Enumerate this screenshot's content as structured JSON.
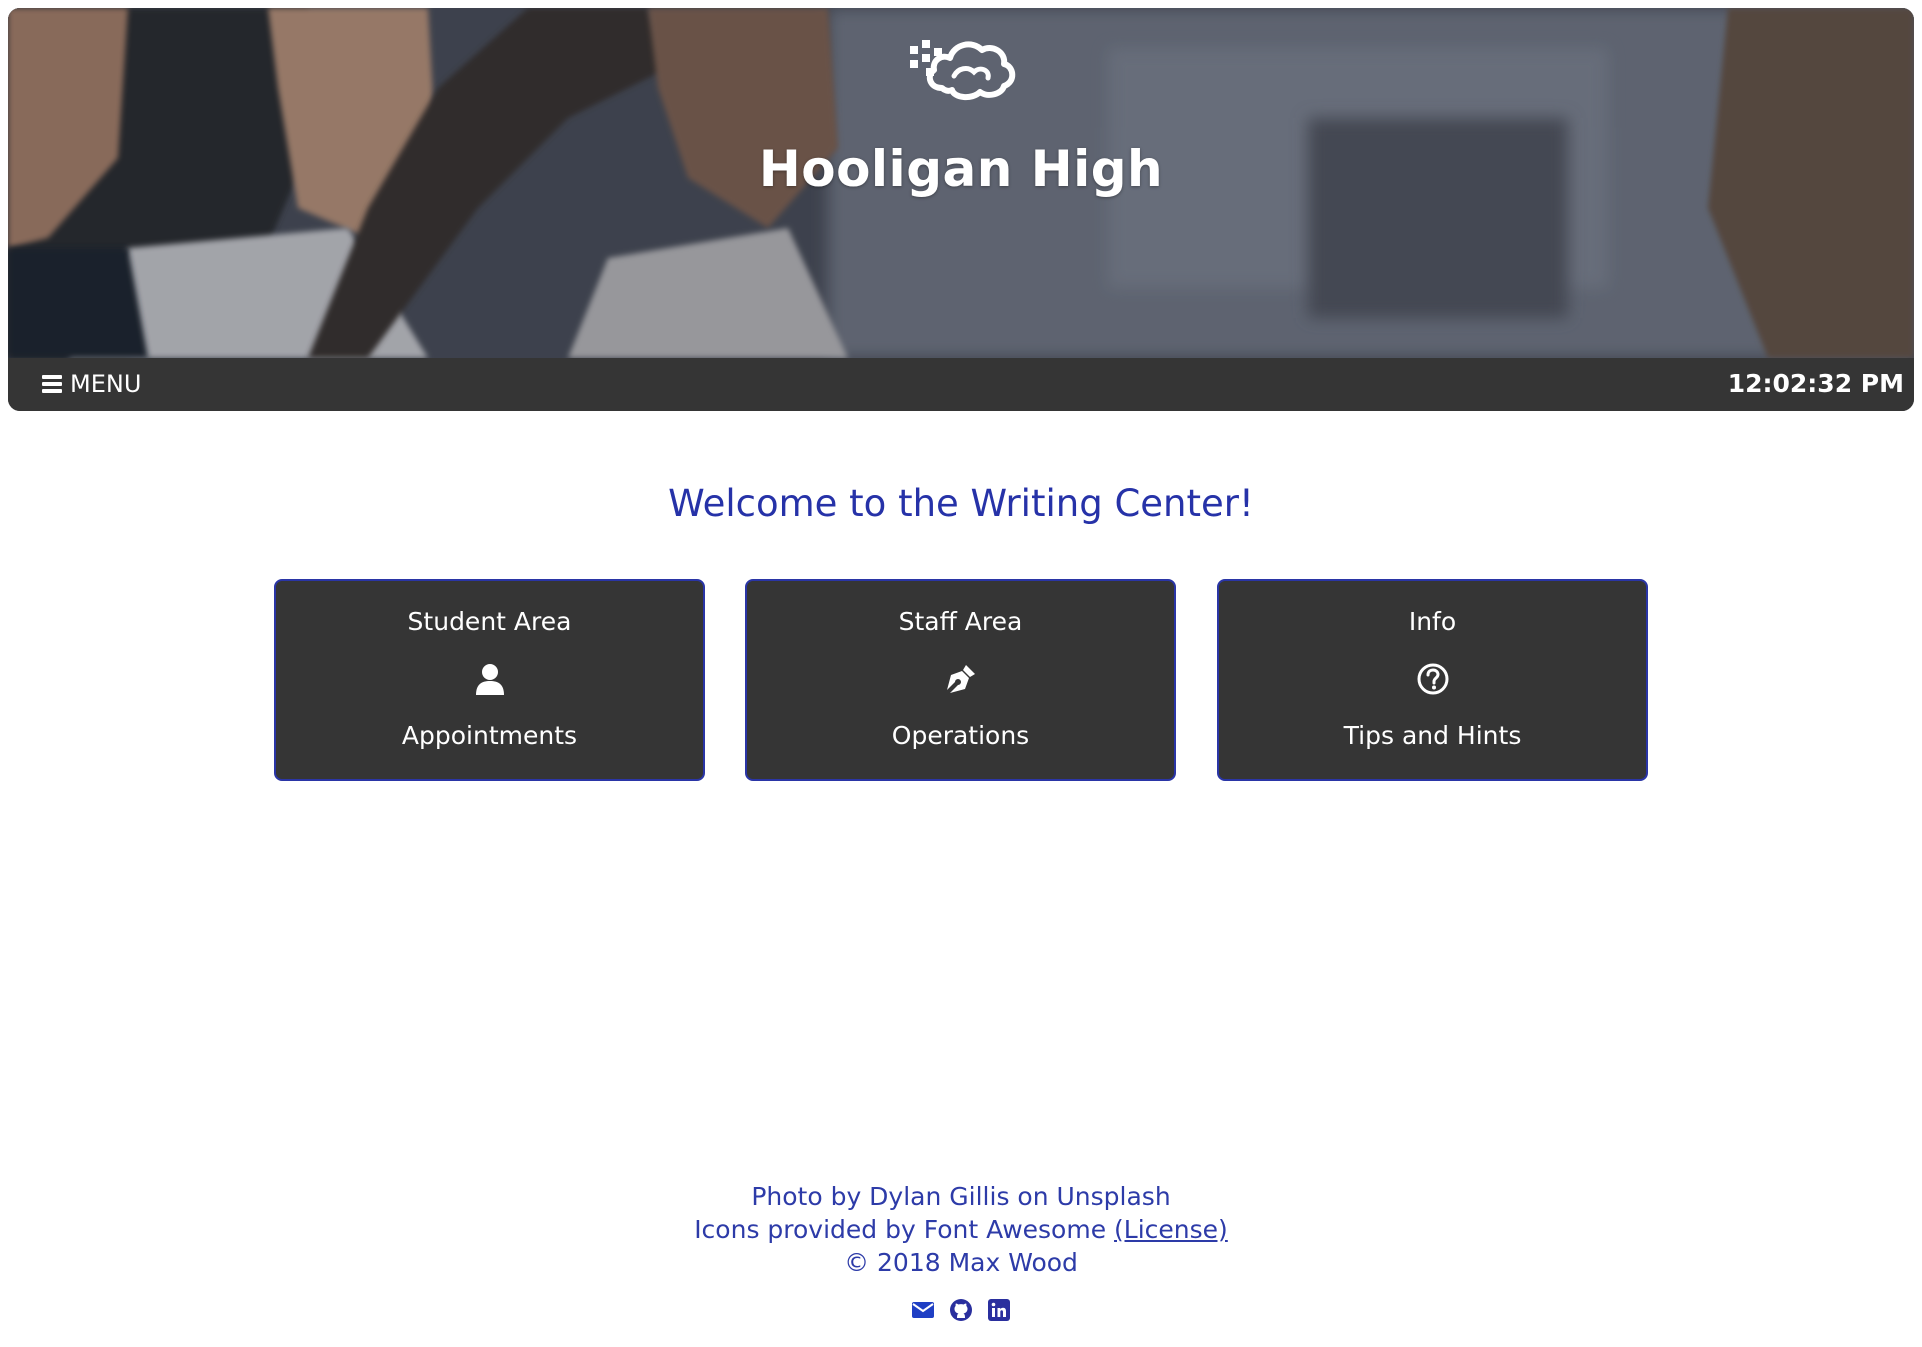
{
  "header": {
    "site_title": "Hooligan High",
    "logo_icon": "cloud-logo-icon",
    "menu_label": "MENU",
    "menu_icon": "bars-icon",
    "clock": "12:02:32 PM"
  },
  "main": {
    "welcome": "Welcome to the Writing Center!",
    "cards": [
      {
        "title": "Student Area",
        "icon": "user-icon",
        "subtitle": "Appointments"
      },
      {
        "title": "Staff Area",
        "icon": "pen-nib-icon",
        "subtitle": "Operations"
      },
      {
        "title": "Info",
        "icon": "question-circle-icon",
        "subtitle": "Tips and Hints"
      }
    ]
  },
  "footer": {
    "photo_credit": "Photo by Dylan Gillis on Unsplash",
    "icons_credit": "Icons provided by Font Awesome",
    "license_link": "(License)",
    "copyright": "© 2018 Max Wood",
    "social": [
      "envelope-icon",
      "github-icon",
      "linkedin-icon"
    ]
  },
  "colors": {
    "accent": "#2632a8",
    "panel": "#353535",
    "text_on_panel": "#ffffff"
  }
}
